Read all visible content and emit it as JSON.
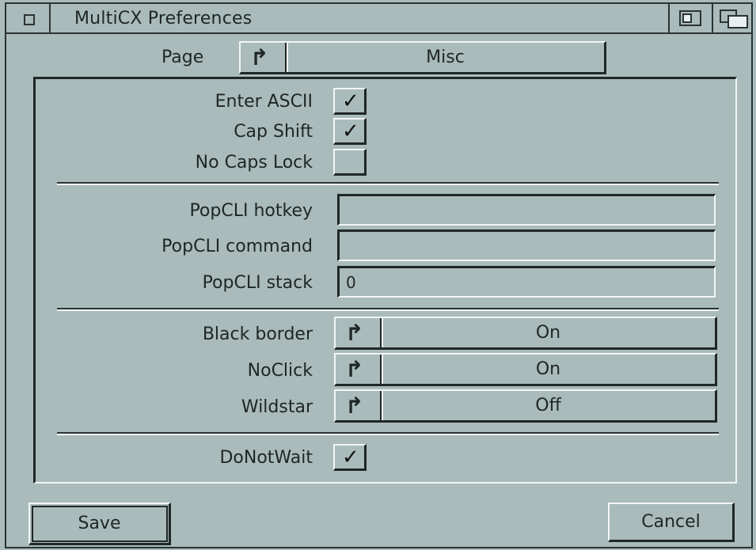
{
  "window": {
    "title": "MultiCX Preferences"
  },
  "page": {
    "label": "Page",
    "value": "Misc"
  },
  "checkboxes": [
    {
      "label": "Enter ASCII",
      "checked": true
    },
    {
      "label": "Cap Shift",
      "checked": true
    },
    {
      "label": "No Caps Lock",
      "checked": false
    }
  ],
  "text_fields": [
    {
      "label": "PopCLI hotkey",
      "value": ""
    },
    {
      "label": "PopCLI command",
      "value": ""
    },
    {
      "label": "PopCLI stack",
      "value": "0"
    }
  ],
  "cycles": [
    {
      "label": "Black border",
      "value": "On"
    },
    {
      "label": "NoClick",
      "value": "On"
    },
    {
      "label": "Wildstar",
      "value": "Off"
    }
  ],
  "donotwait": {
    "label": "DoNotWait",
    "checked": true
  },
  "buttons": {
    "save": "Save",
    "cancel": "Cancel"
  },
  "glyphs": {
    "check": "✓",
    "cycle": "↱"
  },
  "colors": {
    "background": "#a9bbba",
    "shine": "#f1f6f5",
    "shadow": "#1f2727"
  }
}
